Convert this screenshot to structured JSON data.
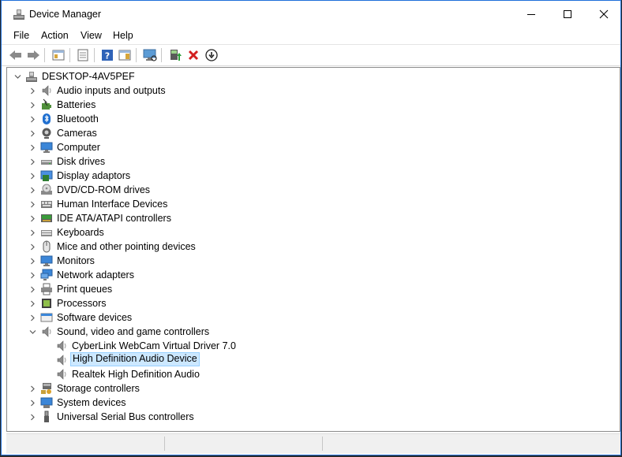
{
  "window": {
    "title": "Device Manager"
  },
  "menu": [
    "File",
    "Action",
    "View",
    "Help"
  ],
  "toolbar": [
    "back",
    "forward",
    "show-hide-console-tree",
    "properties",
    "help",
    "action-pane",
    "scan-hardware",
    "update-driver",
    "uninstall",
    "disable"
  ],
  "tree": {
    "root": "DESKTOP-4AV5PEF",
    "categories": [
      {
        "label": "Audio inputs and outputs",
        "icon": "speaker-icon"
      },
      {
        "label": "Batteries",
        "icon": "battery-icon"
      },
      {
        "label": "Bluetooth",
        "icon": "bluetooth-icon"
      },
      {
        "label": "Cameras",
        "icon": "camera-icon"
      },
      {
        "label": "Computer",
        "icon": "monitor-icon"
      },
      {
        "label": "Disk drives",
        "icon": "disk-icon"
      },
      {
        "label": "Display adaptors",
        "icon": "display-adapter-icon"
      },
      {
        "label": "DVD/CD-ROM drives",
        "icon": "dvd-icon"
      },
      {
        "label": "Human Interface Devices",
        "icon": "hid-icon"
      },
      {
        "label": "IDE ATA/ATAPI controllers",
        "icon": "ide-icon"
      },
      {
        "label": "Keyboards",
        "icon": "keyboard-icon"
      },
      {
        "label": "Mice and other pointing devices",
        "icon": "mouse-icon"
      },
      {
        "label": "Monitors",
        "icon": "monitor-icon"
      },
      {
        "label": "Network adapters",
        "icon": "network-icon"
      },
      {
        "label": "Print queues",
        "icon": "printer-icon"
      },
      {
        "label": "Processors",
        "icon": "processor-icon"
      },
      {
        "label": "Software devices",
        "icon": "software-icon"
      },
      {
        "label": "Sound, video and game controllers",
        "icon": "speaker-icon",
        "expanded": true,
        "children": [
          {
            "label": "CyberLink WebCam Virtual Driver 7.0",
            "icon": "speaker-icon"
          },
          {
            "label": "High Definition Audio Device",
            "icon": "speaker-icon",
            "selected": true
          },
          {
            "label": "Realtek High Definition Audio",
            "icon": "speaker-icon"
          }
        ]
      },
      {
        "label": "Storage controllers",
        "icon": "storage-icon"
      },
      {
        "label": "System devices",
        "icon": "system-icon"
      },
      {
        "label": "Universal Serial Bus controllers",
        "icon": "usb-icon"
      }
    ]
  },
  "colors": {
    "selection": "#cce8ff",
    "selection_border": "#99d1ff",
    "window_border": "#1e6fd9"
  }
}
